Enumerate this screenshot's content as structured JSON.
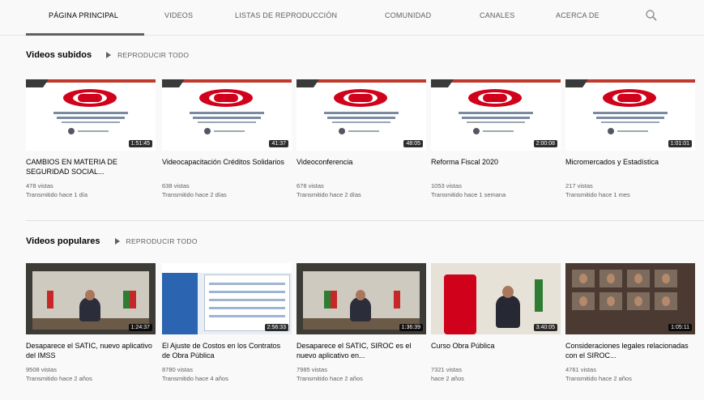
{
  "tabs": [
    {
      "label": "Página principal",
      "active": true
    },
    {
      "label": "Videos",
      "active": false
    },
    {
      "label": "Listas de reproducción",
      "active": false
    },
    {
      "label": "Comunidad",
      "active": false
    },
    {
      "label": "Canales",
      "active": false
    },
    {
      "label": "Acerca de",
      "active": false
    }
  ],
  "search_icon": "search-icon",
  "uploads": {
    "title": "Videos subidos",
    "play_all": "Reproducir todo",
    "videos": [
      {
        "title": "CAMBIOS EN MATERIA DE SEGURIDAD SOCIAL...",
        "views": "478 vistas",
        "date": "Transmitido hace 1 día",
        "duration": "1:51:45"
      },
      {
        "title": "Videocapacitación Créditos Solidarios",
        "views": "638 vistas",
        "date": "Transmitido hace 2 días",
        "duration": "41:37"
      },
      {
        "title": "Videoconferencia",
        "views": "678 vistas",
        "date": "Transmitido hace 2 días",
        "duration": "48:05"
      },
      {
        "title": "Reforma Fiscal 2020",
        "views": "1053 vistas",
        "date": "Transmitido hace 1 semana",
        "duration": "2:00:08"
      },
      {
        "title": "Micromercados y Estadística",
        "views": "217 vistas",
        "date": "Transmitido hace 1 mes",
        "duration": "1:01:01"
      }
    ]
  },
  "popular": {
    "title": "Videos populares",
    "play_all": "Reproducir todo",
    "videos": [
      {
        "title": "Desaparece el SATIC, nuevo aplicativo del IMSS",
        "views": "9508 vistas",
        "date": "Transmitido hace 2 años",
        "duration": "1:24:37"
      },
      {
        "title": "El Ajuste de Costos en los Contratos de Obra Pública",
        "views": "8780 vistas",
        "date": "Transmitido hace 4 años",
        "duration": "2:56:33"
      },
      {
        "title": "Desaparece el SATIC, SIROC es el nuevo aplicativo en...",
        "views": "7985 vistas",
        "date": "Transmitido hace 2 años",
        "duration": "1:36:39"
      },
      {
        "title": "Curso Obra Pública",
        "views": "7321 vistas",
        "date": "hace 2 años",
        "duration": "3:40:05"
      },
      {
        "title": "Consideraciones legales relacionadas con el SIROC...",
        "views": "4761 vistas",
        "date": "Transmitido hace 2 años",
        "duration": "1:05:11"
      }
    ]
  }
}
